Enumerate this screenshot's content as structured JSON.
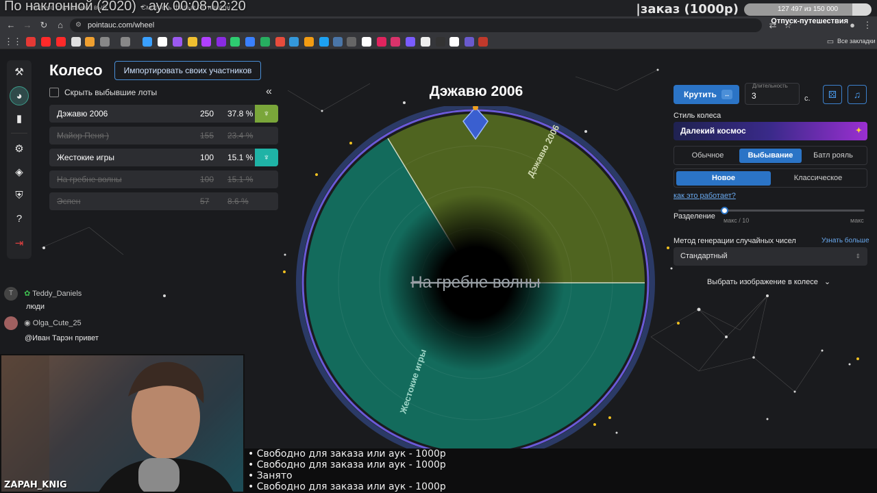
{
  "browser": {
    "overlay_title": "По наклонной (2020) - аук 00:08-02:20",
    "tabs": [
      "Колесо случайного выбора",
      "Смотреть фильм По наклонной"
    ],
    "url": "pointauc.com/wheel",
    "bookmarks_label": "Все закладки"
  },
  "stream": {
    "order_label": "|заказ (1000р)",
    "order_progress": "127 497 из 150 000",
    "order_fraction": 0.85,
    "vacation": "Отпуск-путешествия"
  },
  "sidebar": {
    "icons": [
      "gavel-icon",
      "wheel-icon",
      "bar-chart-icon",
      "gear-icon",
      "layers-icon",
      "shield-icon",
      "help-icon",
      "logout-icon"
    ]
  },
  "page": {
    "title": "Колесо",
    "import_button": "Импортировать своих участников",
    "hide_checkbox": "Скрыть выбывшие лоты",
    "collapse": "«"
  },
  "lots": [
    {
      "name": "Дэжавю 2006",
      "amount": "250",
      "percent": "37.8 %",
      "out": false,
      "color": "#7aa63a"
    },
    {
      "name": "Майор Пеня )",
      "amount": "155",
      "percent": "23.4 %",
      "out": true,
      "color": ""
    },
    {
      "name": "Жестокие игры",
      "amount": "100",
      "percent": "15.1 %",
      "out": false,
      "color": "#1fb3a6"
    },
    {
      "name": "На гребне волны",
      "amount": "100",
      "percent": "15.1 %",
      "out": true,
      "color": ""
    },
    {
      "name": "Эспен",
      "amount": "57",
      "percent": "8.6 %",
      "out": true,
      "color": ""
    }
  ],
  "wheel": {
    "winner": "Дэжавю 2006",
    "center_label": "На гребне волны",
    "segments": [
      {
        "label": "Дэжавю 2006",
        "color": "#4f6420"
      },
      {
        "label": "Жестокие игры",
        "color": "#136b5c"
      }
    ]
  },
  "controls": {
    "spin_button": "Крутить",
    "spin_mini": "↔",
    "duration_label": "Длительность",
    "duration_value": "3",
    "seconds": "с.",
    "style_label": "Стиль колеса",
    "style_value": "Далекий космос",
    "modes": [
      "Обычное",
      "Выбывание",
      "Батл рояль"
    ],
    "mode_active": "Выбывание",
    "variants": [
      "Новое",
      "Классическое"
    ],
    "variant_active": "Новое",
    "how_link": "как это работает?",
    "split_label": "Разделение",
    "split_min": "макс / 10",
    "split_max": "макс",
    "rng_label": "Метод генерации случайных чисел",
    "rng_more": "Узнать больше",
    "rng_value": "Стандартный",
    "image_choose": "Выбрать изображение в колесе"
  },
  "chat": [
    {
      "user": "Teddy_Daniels",
      "message": "люди",
      "avatar_letter": "T"
    },
    {
      "user": "Olga_Cute_25",
      "message": "@Иван Тарэн привет"
    }
  ],
  "camera": {
    "name": "ZAPAH_KNIG"
  },
  "info": [
    "• Свободно для заказа или аук - 1000р",
    "• Свободно для заказа или аук - 1000р",
    "• Занято",
    "• Свободно для заказа или аук - 1000р"
  ]
}
